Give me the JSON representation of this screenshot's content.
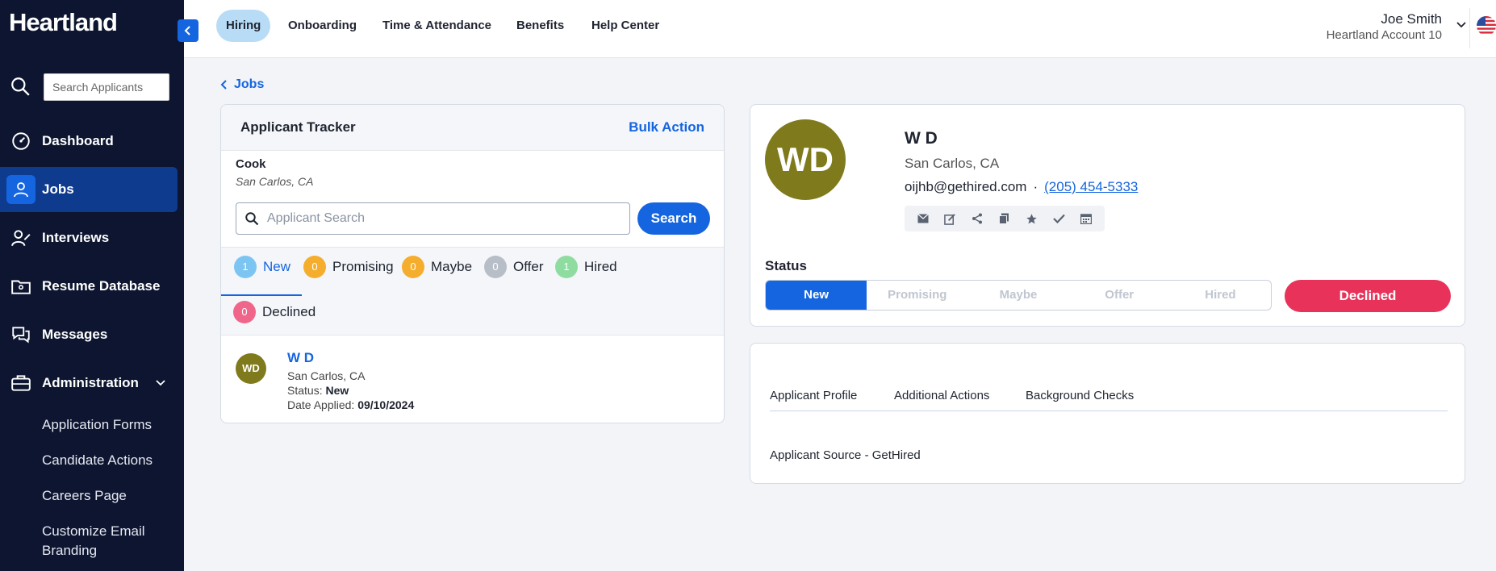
{
  "brand": "Heartland",
  "sidebar": {
    "search_placeholder": "Search Applicants",
    "items": [
      {
        "label": "Dashboard"
      },
      {
        "label": "Jobs"
      },
      {
        "label": "Interviews"
      },
      {
        "label": "Resume Database"
      },
      {
        "label": "Messages"
      },
      {
        "label": "Administration"
      }
    ],
    "admin_subitems": [
      "Application Forms",
      "Candidate Actions",
      "Careers Page",
      "Customize Email",
      "Branding"
    ]
  },
  "topnav": {
    "tabs": [
      "Hiring",
      "Onboarding",
      "Time & Attendance",
      "Benefits",
      "Help Center"
    ],
    "user_name": "Joe Smith",
    "account": "Heartland Account 10"
  },
  "back_label": "Jobs",
  "tracker": {
    "title": "Applicant Tracker",
    "bulk_action": "Bulk Action",
    "job_title": "Cook",
    "job_location": "San Carlos, CA",
    "search_placeholder": "Applicant Search",
    "search_button": "Search",
    "stages": [
      {
        "label": "New",
        "count": "1",
        "color": "#7cc5f2"
      },
      {
        "label": "Promising",
        "count": "0",
        "color": "#f5ad2e"
      },
      {
        "label": "Maybe",
        "count": "0",
        "color": "#f5ad2e"
      },
      {
        "label": "Offer",
        "count": "0",
        "color": "#b8bec8"
      },
      {
        "label": "Hired",
        "count": "1",
        "color": "#8fdca0"
      },
      {
        "label": "Declined",
        "count": "0",
        "color": "#f0668a"
      }
    ],
    "applicant": {
      "initials": "WD",
      "name": "W D",
      "location": "San Carlos, CA",
      "status_label": "Status:",
      "status": "New",
      "date_label": "Date Applied:",
      "date": "09/10/2024"
    }
  },
  "profile": {
    "initials": "WD",
    "name": "W D",
    "location": "San Carlos, CA",
    "email": "oijhb@gethired.com",
    "separator": "·",
    "phone": "(205) 454-5333",
    "status_label": "Status",
    "statuses": [
      "New",
      "Promising",
      "Maybe",
      "Offer",
      "Hired"
    ],
    "declined": "Declined",
    "accent": "#1565e0",
    "declined_color": "#e8325a"
  },
  "details": {
    "tabs": [
      "Applicant Profile",
      "Additional Actions",
      "Background Checks"
    ],
    "source": "Applicant Source - GetHired"
  }
}
